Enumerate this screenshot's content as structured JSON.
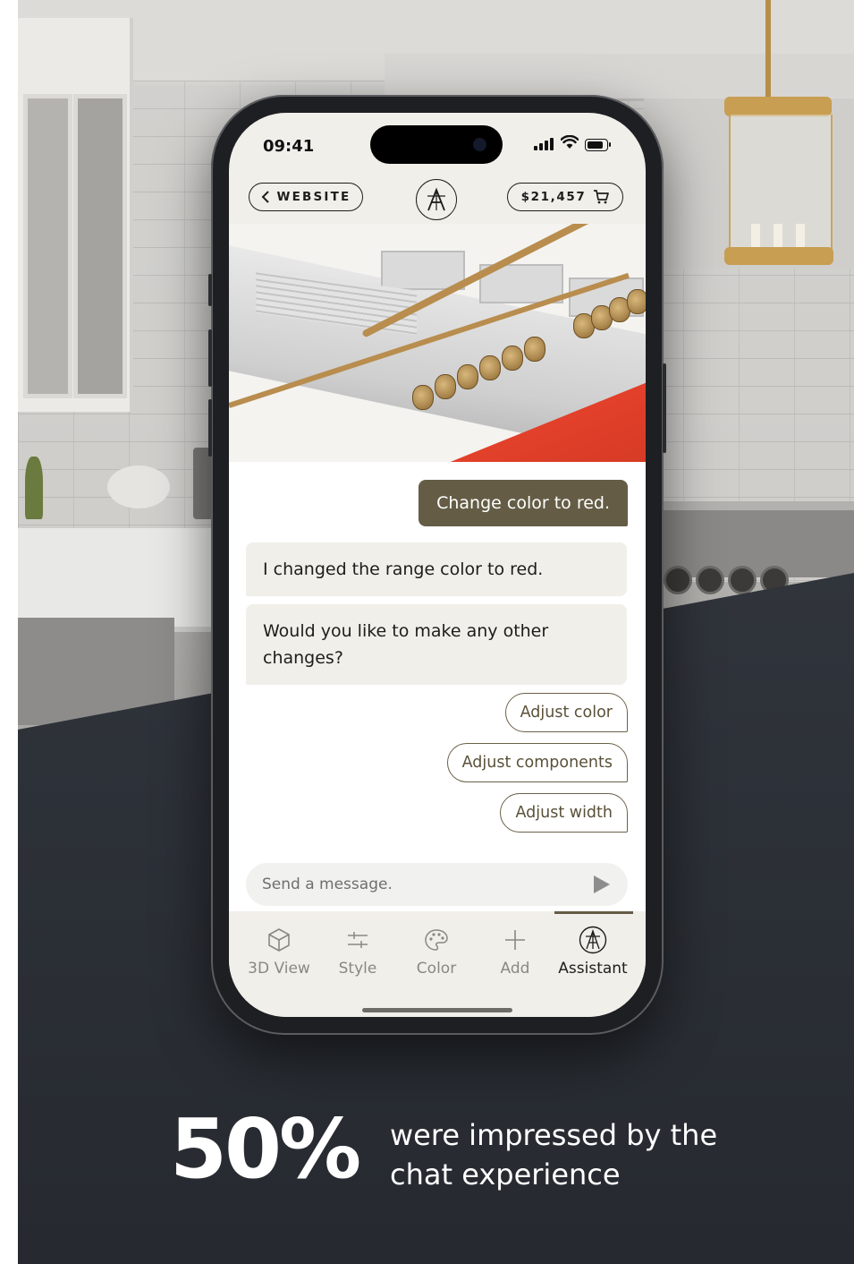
{
  "status_bar": {
    "time": "09:41"
  },
  "header": {
    "back_label": "WEBSITE",
    "cart_total": "$21,457",
    "logo_glyph": "A",
    "back_icon": "chevron-left-icon",
    "cart_icon": "cart-icon"
  },
  "chat": {
    "messages": [
      {
        "role": "user",
        "text": "Change color to red."
      },
      {
        "role": "assistant",
        "text": "I changed the range color to red."
      },
      {
        "role": "assistant",
        "text": "Would you like to make any other changes?"
      }
    ],
    "suggestions": [
      "Adjust color",
      "Adjust components",
      "Adjust width"
    ],
    "composer_placeholder": "Send a message."
  },
  "tabs": [
    {
      "label": "3D View",
      "icon": "cube-icon",
      "active": false
    },
    {
      "label": "Style",
      "icon": "sliders-icon",
      "active": false
    },
    {
      "label": "Color",
      "icon": "palette-icon",
      "active": false
    },
    {
      "label": "Add",
      "icon": "plus-icon",
      "active": false
    },
    {
      "label": "Assistant",
      "icon": "assistant-logo-icon",
      "active": true
    }
  ],
  "stat": {
    "value": "50%",
    "caption_line1": "were impressed by the",
    "caption_line2": "chat experience"
  },
  "colors": {
    "user_bubble": "#645c45",
    "assistant_bubble": "#f1efea",
    "range_red": "#d63a25",
    "brass": "#b88d4e",
    "dark_band": "#2d3138"
  }
}
